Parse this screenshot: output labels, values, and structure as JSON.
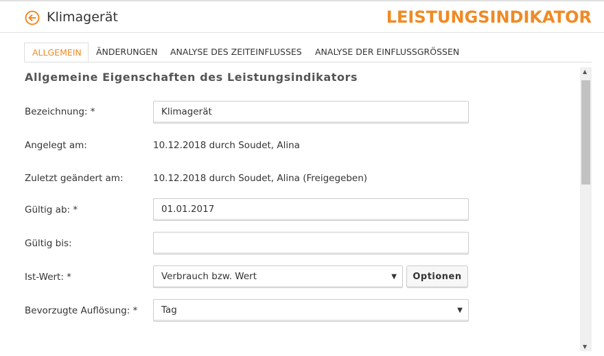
{
  "header": {
    "title": "Klimagerät",
    "brand": "LEISTUNGSINDIKATOR",
    "back_icon": "arrow-left-circle-icon",
    "accent_color": "#f08a24"
  },
  "tabs": [
    {
      "label": "ALLGEMEIN",
      "active": true
    },
    {
      "label": "ÄNDERUNGEN",
      "active": false
    },
    {
      "label": "ANALYSE DES ZEITEINFLUSSES",
      "active": false
    },
    {
      "label": "ANALYSE DER EINFLUSSGRÖSSEN",
      "active": false
    }
  ],
  "section": {
    "title": "Allgemeine Eigenschaften des Leistungsindikators"
  },
  "form": {
    "bezeichnung": {
      "label": "Bezeichnung: *",
      "value": "Klimagerät"
    },
    "angelegt": {
      "label": "Angelegt am:",
      "value": "10.12.2018 durch Soudet, Alina"
    },
    "geaendert": {
      "label": "Zuletzt geändert am:",
      "value": "10.12.2018 durch Soudet, Alina (Freigegeben)"
    },
    "gueltig_ab": {
      "label": "Gültig ab: *",
      "value": "01.01.2017"
    },
    "gueltig_bis": {
      "label": "Gültig bis:",
      "value": ""
    },
    "ist_wert": {
      "label": "Ist-Wert: *",
      "value": "Verbrauch bzw. Wert",
      "button": "Optionen"
    },
    "aufloesung": {
      "label": "Bevorzugte Auflösung: *",
      "value": "Tag"
    }
  }
}
